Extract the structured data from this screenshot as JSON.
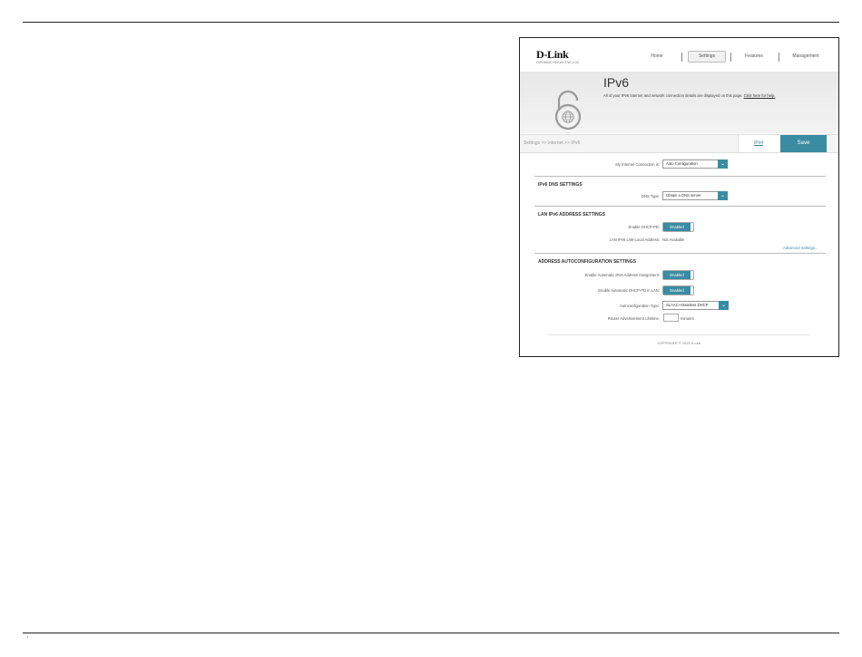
{
  "header": {
    "brand": "D-Link",
    "model_line": "DIR-860L   HW:A1   FW:1.00",
    "nav": {
      "home": "Home",
      "settings": "Settings",
      "features": "Features",
      "management": "Management"
    }
  },
  "banner": {
    "title": "IPv6",
    "description": "All of your IPv6 Internet and network connection details are displayed on this page.",
    "help_link": "Click here for help."
  },
  "breadcrumb": {
    "path": "Settings >> Internet >> IPv6",
    "ipv4_link": "IPv4",
    "save_label": "Save"
  },
  "connection": {
    "label": "My Internet Connection is:",
    "value": "Auto Configuration"
  },
  "dns": {
    "section_title": "IPv6 DNS SETTINGS",
    "type_label": "DNS Type:",
    "type_value": "Obtain a DNS server"
  },
  "lan": {
    "section_title": "LAN IPv6 ADDRESS SETTINGS",
    "dhcp_pd_label": "Enable DHCP-PD:",
    "dhcp_pd_state": "Enabled",
    "link_local_label": "LAN IPv6 Link-Local Address:",
    "link_local_value": "Not Available",
    "advanced_link": "Advanced Settings..."
  },
  "autoconfig": {
    "section_title": "ADDRESS AUTOCONFIGURATION SETTINGS",
    "auto_assign_label": "Enable Automatic IPv6 Address Assignment:",
    "auto_assign_state": "Enabled",
    "auto_dhcp_pd_label": "Enable Automatic DHCP-PD in LAN:",
    "auto_dhcp_pd_state": "Enabled",
    "type_label": "Autoconfiguration Type:",
    "type_value": "SLAAC+Stateless DHCP",
    "lifetime_label": "Router Advertisement Lifetime:",
    "lifetime_unit": "minutes"
  },
  "footer": {
    "copyright": "COPYRIGHT © 2013 D-Link"
  },
  "icons": {
    "dropdown": "chevron-down-icon",
    "banner": "lock-globe-icon"
  },
  "colors": {
    "accent": "#3a8ca3",
    "banner_bg": "#eeeeee"
  }
}
